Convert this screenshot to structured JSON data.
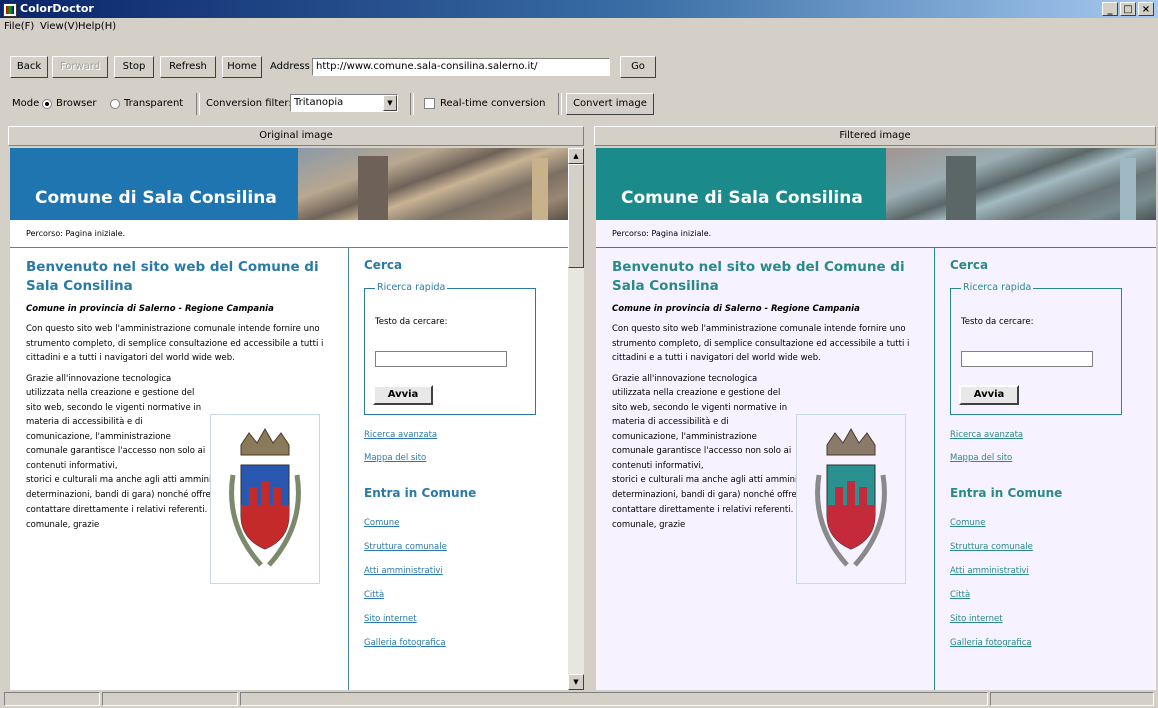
{
  "window": {
    "title": "ColorDoctor",
    "minimize": "_",
    "maximize": "□",
    "close": "×"
  },
  "menu": [
    "File(F)",
    "View(V)",
    "Help(H)"
  ],
  "toolbar": {
    "back": "Back",
    "forward": "Forward",
    "stop": "Stop",
    "refresh": "Refresh",
    "home": "Home",
    "address_label": "Address",
    "address_value": "http://www.comune.sala-consilina.salerno.it/",
    "go": "Go"
  },
  "options": {
    "mode_label": "Mode",
    "mode_browser": "Browser",
    "mode_transparent": "Transparent",
    "selected_mode": "Browser",
    "filter_label": "Conversion filter:",
    "filter_value": "Tritanopia",
    "realtime_label": "Real-time conversion",
    "realtime_checked": false,
    "convert": "Convert image"
  },
  "panes": {
    "original_header": "Original image",
    "filtered_header": "Filtered image"
  },
  "page": {
    "banner_title": "Comune di Sala Consilina",
    "breadcrumb": "Percorso: Pagina iniziale.",
    "heading": "Benvenuto nel sito web del Comune di Sala Consilina",
    "subtitle": "Comune in provincia di Salerno - Regione Campania",
    "intro": "Con questo sito web l'amministrazione comunale intende fornire uno strumento completo, di semplice consultazione ed accessibile a tutti i cittadini e a tutti i navigatori del world wide web.",
    "body_narrow": "Grazie all'innovazione tecnologica utilizzata nella creazione e gestione del sito web, secondo le vigenti normative in materia di accessibilità e di comunicazione, l'amministrazione comunale garantisce l'accesso non solo ai contenuti informativi,",
    "body_wide": "storici e culturali ma anche agli atti amministrativi (delibere, determinazioni, bandi di gara) nonché offrendo la possibilità di contattare direttamente i relativi referenti. L'amministrazione comunale, grazie",
    "search_title": "Cerca",
    "search_legend": "Ricerca rapida",
    "search_label": "Testo da cercare:",
    "search_button": "Avvia",
    "link_advanced": "Ricerca avanzata",
    "link_map": "Mappa del sito",
    "enter_title": "Entra in Comune",
    "links": [
      "Comune",
      "Struttura comunale",
      "Atti amministrativi",
      "Città",
      "Sito internet",
      "Galleria fotografica"
    ]
  },
  "colors": {
    "original_banner": "#1f75b0",
    "filtered_banner": "#1a8a8a",
    "original_bg": "#ffffff",
    "filtered_bg": "#f6f2ff",
    "accent": "#2a7aa8"
  }
}
